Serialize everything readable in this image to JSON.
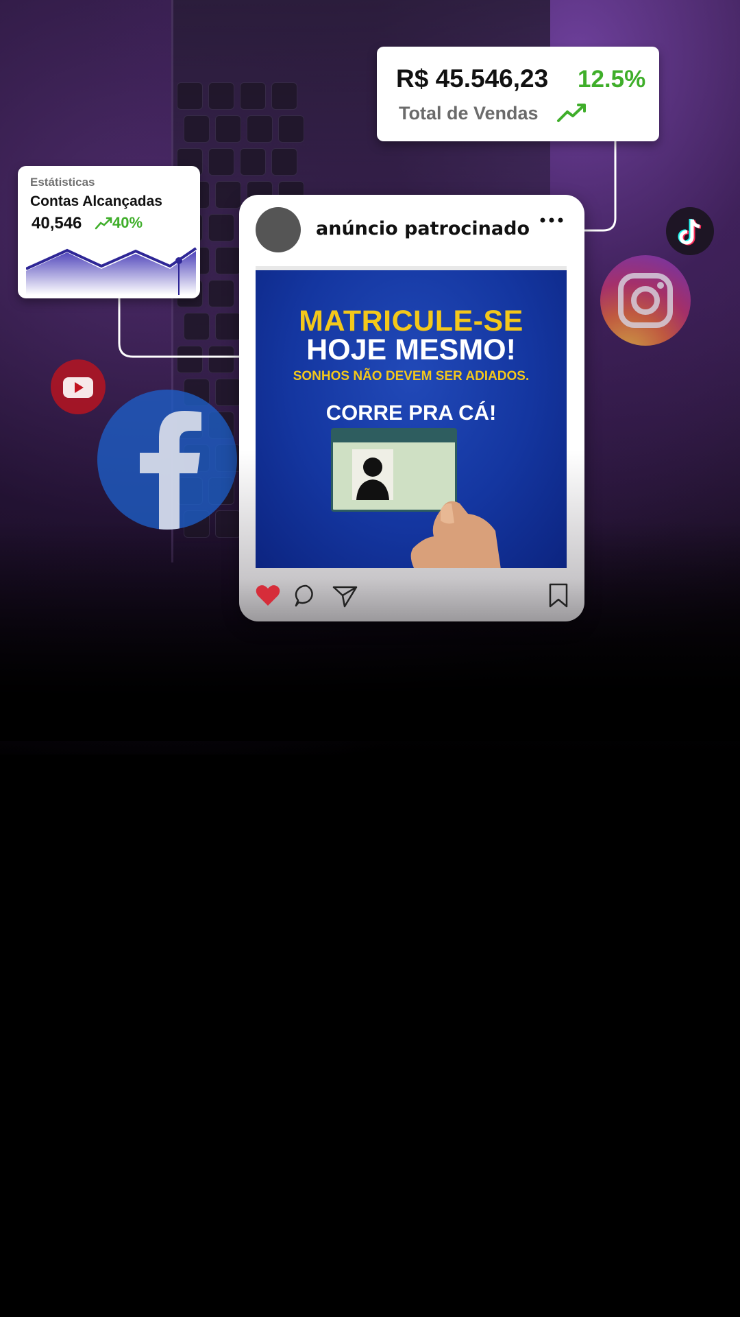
{
  "sales_card": {
    "amount": "R$ 45.546,23",
    "percent": "12.5%",
    "label": "Total de Vendas",
    "trend_icon": "trending-up-icon",
    "accent": "#3fae2a"
  },
  "stats_card": {
    "title": "Estátisticas",
    "heading": "Contas Alcançadas",
    "value": "40,546",
    "percent": "40%",
    "trend_icon": "trending-up-icon"
  },
  "post": {
    "username": "anúncio patrocinado",
    "menu_icon": "more-horizontal-icon",
    "ad_line1": "MATRICULE-SE",
    "ad_line2": "HOJE MESMO!",
    "ad_line3": "SONHOS NÃO DEVEM SER ADIADOS.",
    "ad_line4": "CORRE PRA CÁ!",
    "actions": [
      "heart-icon",
      "comment-icon",
      "share-icon",
      "bookmark-icon"
    ],
    "like_color": "#d62d3a"
  },
  "social_icons": [
    "tiktok-icon",
    "instagram-icon",
    "youtube-icon",
    "facebook-icon"
  ]
}
